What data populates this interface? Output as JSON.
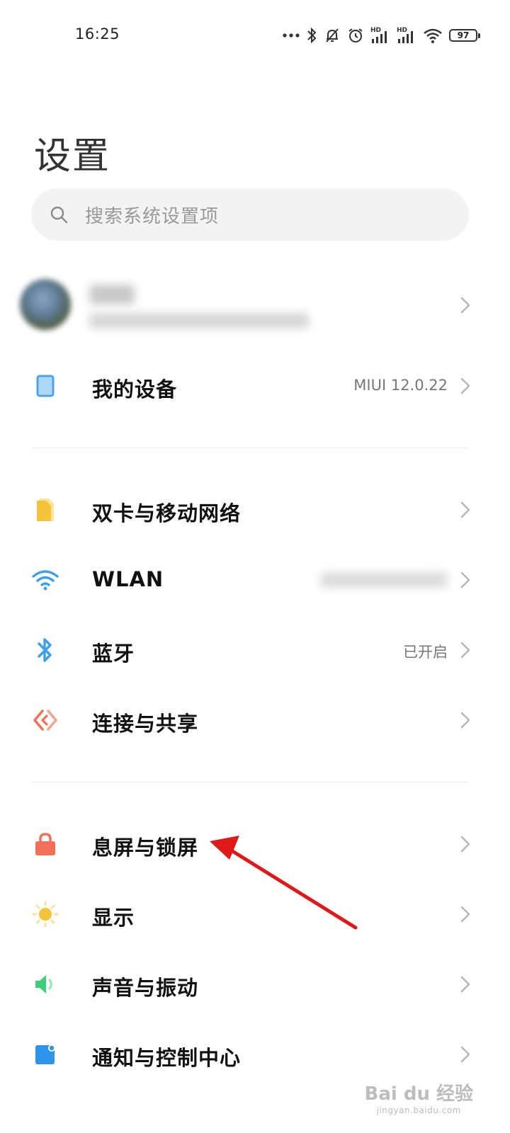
{
  "status_bar": {
    "time": "16:25",
    "battery": "97",
    "signal_label_1": "HD",
    "signal_label_2": "HD"
  },
  "page": {
    "title": "设置"
  },
  "search": {
    "placeholder": "搜索系统设置项"
  },
  "sections": [
    {
      "items": [
        {
          "label": "我的设备",
          "value": "MIUI 12.0.22",
          "icon": "device-icon",
          "color": "#5aaee8"
        }
      ]
    },
    {
      "items": [
        {
          "label": "双卡与移动网络",
          "value": "",
          "icon": "sim-card-icon",
          "color": "#f5c33b"
        },
        {
          "label": "WLAN",
          "value": "",
          "icon": "wifi-icon",
          "color": "#3aa0e8"
        },
        {
          "label": "蓝牙",
          "value": "已开启",
          "icon": "bluetooth-icon",
          "color": "#3aa0e8"
        },
        {
          "label": "连接与共享",
          "value": "",
          "icon": "share-icon",
          "color": "#f0705a"
        }
      ]
    },
    {
      "items": [
        {
          "label": "息屏与锁屏",
          "value": "",
          "icon": "lock-icon",
          "color": "#f0705a"
        },
        {
          "label": "显示",
          "value": "",
          "icon": "sun-icon",
          "color": "#f5c33b"
        },
        {
          "label": "声音与振动",
          "value": "",
          "icon": "speaker-icon",
          "color": "#3fcf7a"
        },
        {
          "label": "通知与控制中心",
          "value": "",
          "icon": "notification-icon",
          "color": "#2f95ea"
        }
      ]
    }
  ],
  "watermark": {
    "brand": "Bai du 经验",
    "url": "jingyan.baidu.com"
  }
}
